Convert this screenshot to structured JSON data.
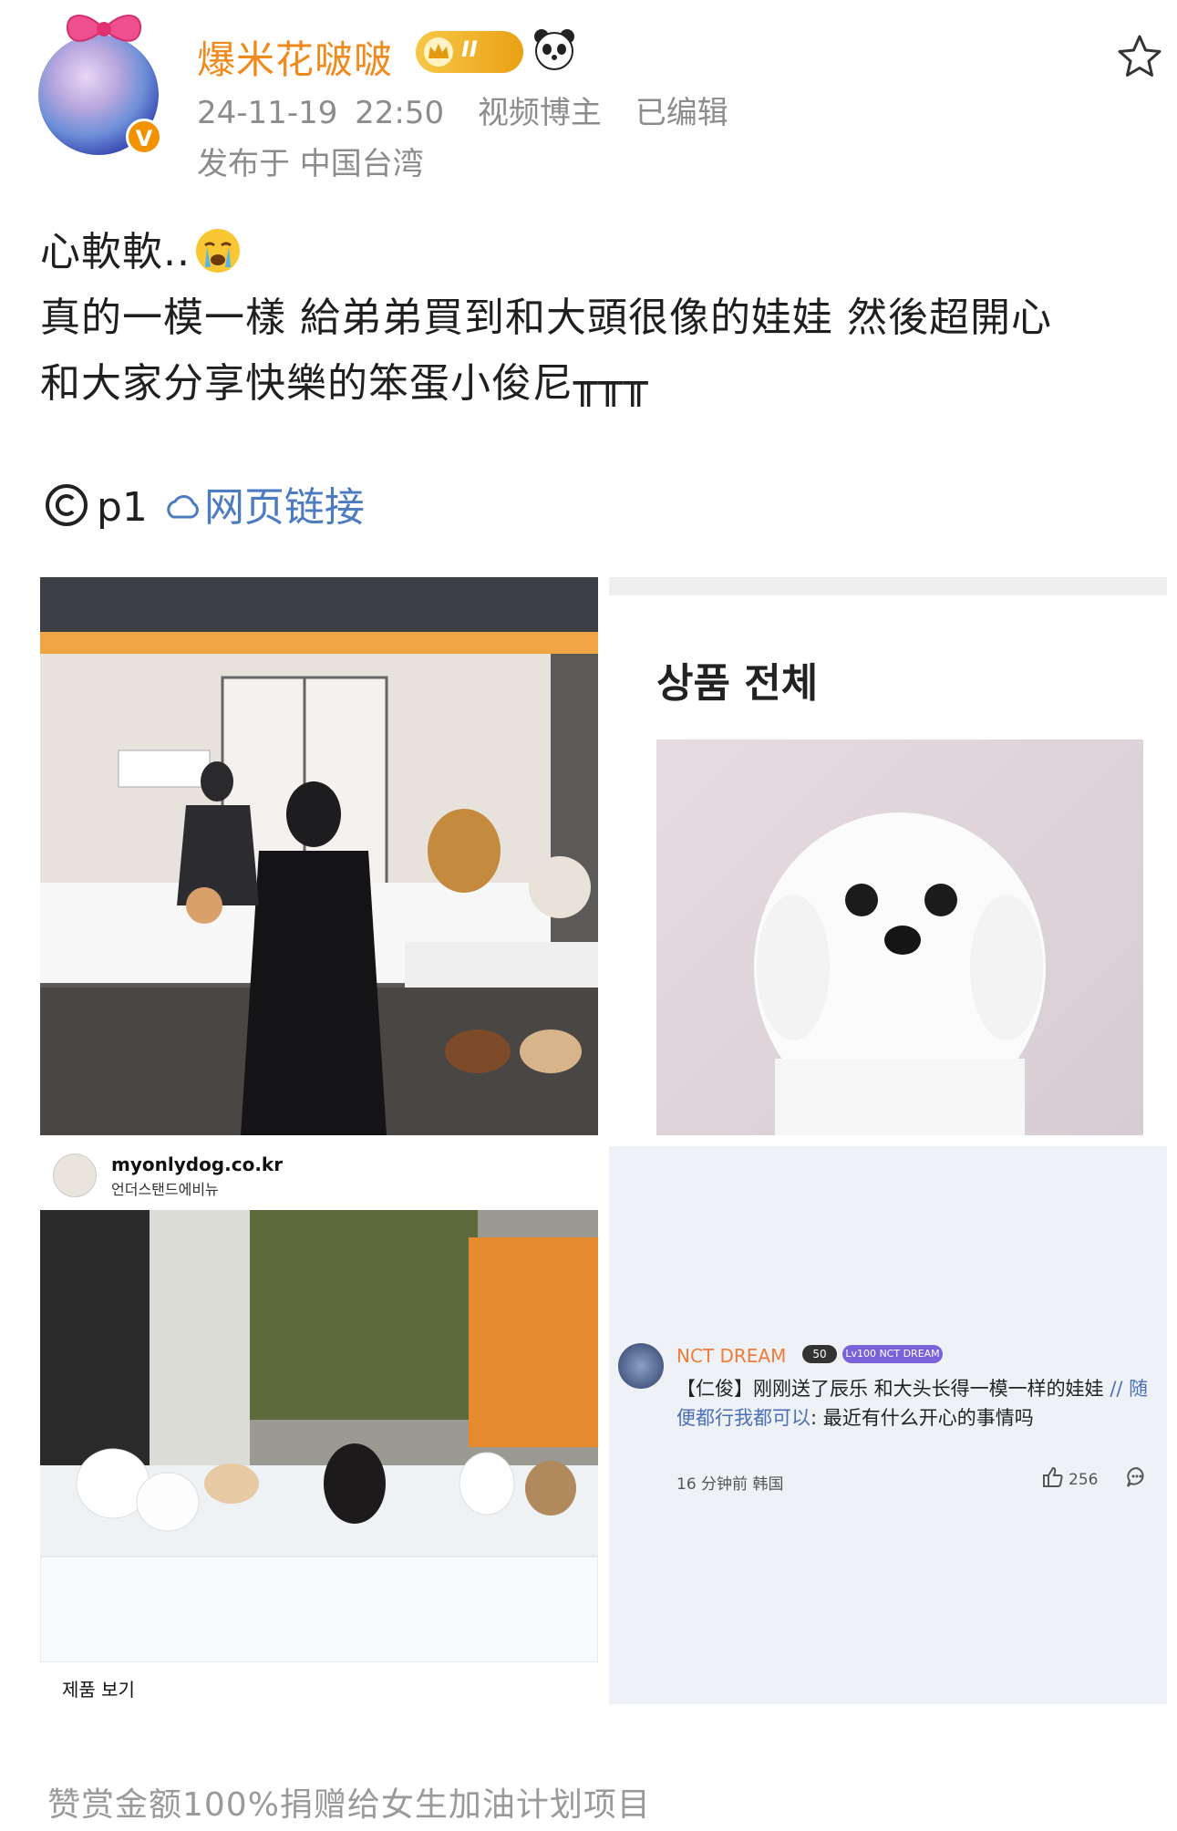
{
  "post": {
    "username": "爆米花啵啵",
    "rank_level": "II",
    "timestamp": "24-11-19 22:50",
    "role": "视频博主",
    "edited": "已编辑",
    "location": "发布于 中国台湾",
    "text_line1": "心軟軟..",
    "text_line2": "真的一模一樣 給弟弟買到和大頭很像的娃娃 然後超開心",
    "text_line3": "和大家分享快樂的笨蛋小俊尼╥╥╥",
    "p1_label": "p1",
    "link_label": "网页链接"
  },
  "images": {
    "img2_heading": "상품 전체",
    "img3_store_name": "myonlydog.co.kr",
    "img3_store_sub": "언더스탠드에비뉴",
    "img3_view_link": "제품 보기",
    "img4": {
      "commenter": "NCT DREAM",
      "level": "50",
      "fan_badge": "Lv100 NCT DREAM",
      "comment_prefix": "【仁俊】刚刚送了辰乐 和大头长得一模一样的娃娃 ",
      "comment_mention": "// 随便都行我都可以",
      "comment_suffix": ": 最近有什么开心的事情吗",
      "time": "16 分钟前 韩国",
      "likes": "256"
    }
  },
  "footer": {
    "reward_text": "赞赏金额100%捐赠给女生加油计划项目"
  },
  "icons": {
    "verified": "verified-badge-icon",
    "rank": "crown-icon",
    "emoji": "panda-icon",
    "favorite": "star-icon",
    "crying": "crying-emoji-icon",
    "copyright": "copyright-icon",
    "link": "link-icon"
  },
  "colors": {
    "username": "#f08a1c",
    "link": "#4c7bc2",
    "meta": "#8c8c8c"
  }
}
